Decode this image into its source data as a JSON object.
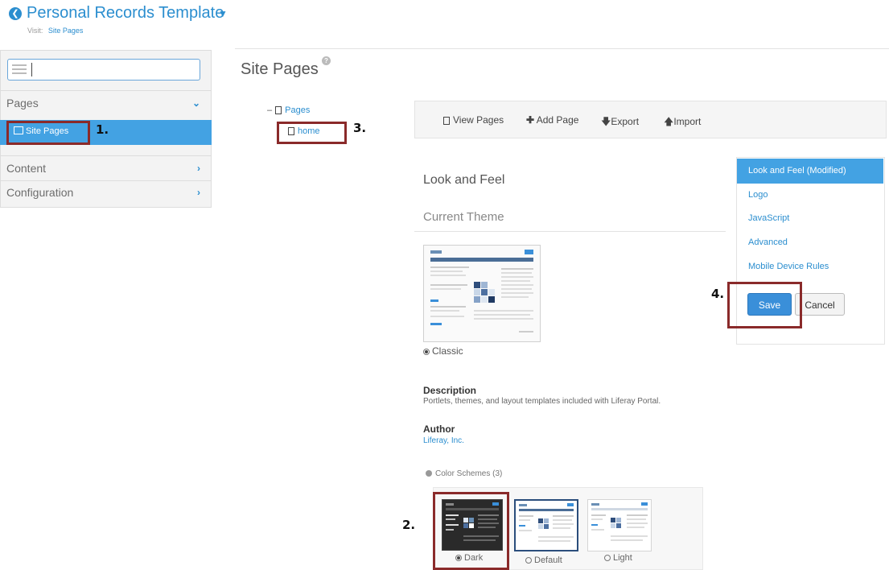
{
  "header": {
    "title": "Personal Records Template",
    "visit_label": "Visit:",
    "visit_link": "Site Pages"
  },
  "sidebar": {
    "search_value": "",
    "sections": [
      {
        "label": "Pages",
        "chevron": "⌄"
      },
      {
        "label": "Content",
        "chevron": "›"
      },
      {
        "label": "Configuration",
        "chevron": "›"
      }
    ],
    "active_item": "Site Pages"
  },
  "page_title": "Site Pages",
  "help_glyph": "?",
  "tree": {
    "root": "Pages",
    "child": "home"
  },
  "toolbar": {
    "view_pages": "View Pages",
    "add_page": "Add Page",
    "export": "Export",
    "import": "Import"
  },
  "look_and_feel": {
    "title": "Look and Feel",
    "current_theme_title": "Current Theme",
    "theme_name": "Classic",
    "description_heading": "Description",
    "description": "Portlets, themes, and layout templates included with Liferay Portal.",
    "author_heading": "Author",
    "author": "Liferay, Inc.",
    "color_schemes_label": "Color Schemes (3)",
    "color_schemes": [
      {
        "name": "Dark",
        "selected": true
      },
      {
        "name": "Default",
        "selected": false
      },
      {
        "name": "Light",
        "selected": false
      }
    ]
  },
  "right_panel": {
    "items": [
      "Look and Feel (Modified)",
      "Logo",
      "JavaScript",
      "Advanced",
      "Mobile Device Rules"
    ],
    "save_label": "Save",
    "cancel_label": "Cancel"
  },
  "annotations": {
    "step1": "1.",
    "step2": "2.",
    "step3": "3.",
    "step4": "4."
  },
  "colors": {
    "accent": "#2b8ecf",
    "active_bg": "#43a2e3",
    "annotation_box": "#8a2a2a",
    "save_button": "#3a8fd9"
  }
}
